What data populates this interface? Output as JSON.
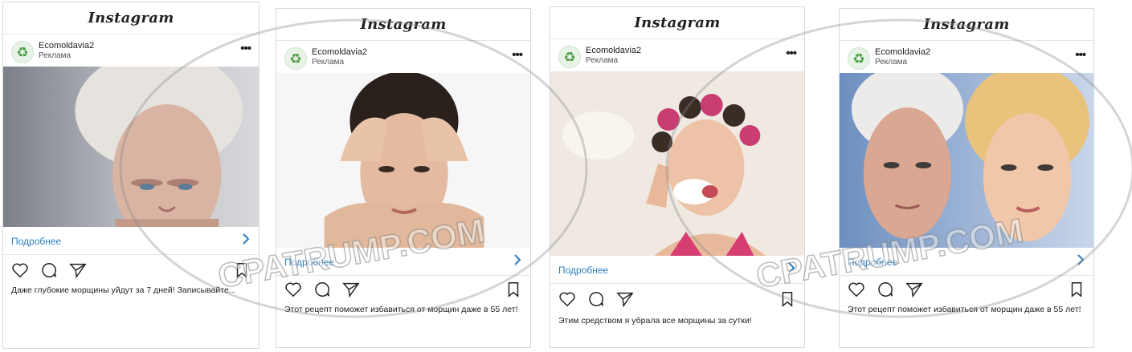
{
  "cards": [
    {
      "brand": "Instagram",
      "account": "Ecomoldavia2",
      "sponsored": "Реклама",
      "more": "•••",
      "cta": "Подробнее",
      "caption": "Даже глубокие морщины уйдут за 7 дней! Записывайте..."
    },
    {
      "brand": "Instagram",
      "account": "Ecomoldavia2",
      "sponsored": "Реклама",
      "more": "•••",
      "cta": "Подробнее",
      "caption": "Этот рецепт поможет избавиться от морщин даже в 55 лет!"
    },
    {
      "brand": "Instagram",
      "account": "Ecomoldavia2",
      "sponsored": "Реклама",
      "more": "•••",
      "cta": "Подробнее",
      "caption": "Этим средством я убрала все морщины за сутки!"
    },
    {
      "brand": "Instagram",
      "account": "Ecomoldavia2",
      "sponsored": "Реклама",
      "more": "•••",
      "cta": "Подробнее",
      "caption": "Этот рецепт поможет избавиться от морщин даже в 55 лет!"
    }
  ],
  "watermark": "CPATRUMP.COM",
  "icons": {
    "avatar": "recycle-icon",
    "like": "heart-icon",
    "comment": "comment-icon",
    "share": "send-icon",
    "save": "bookmark-icon",
    "cta": "chevron-right-icon"
  },
  "colors": {
    "link": "#2d7fc1",
    "text": "#222222",
    "border": "#d9d9d9",
    "avatar": "#4a9a44"
  }
}
